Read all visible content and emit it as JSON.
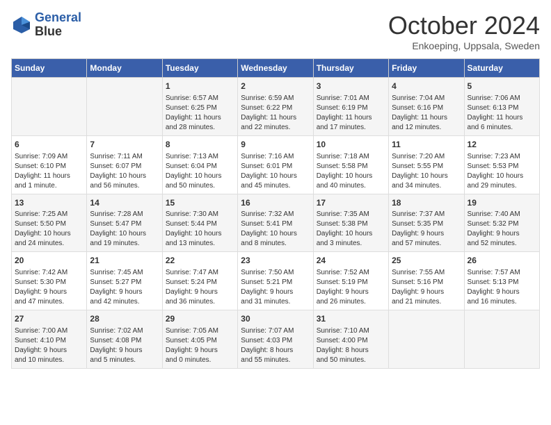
{
  "header": {
    "logo_line1": "General",
    "logo_line2": "Blue",
    "month": "October 2024",
    "location": "Enkoeping, Uppsala, Sweden"
  },
  "weekdays": [
    "Sunday",
    "Monday",
    "Tuesday",
    "Wednesday",
    "Thursday",
    "Friday",
    "Saturday"
  ],
  "weeks": [
    [
      {
        "day": "",
        "info": ""
      },
      {
        "day": "",
        "info": ""
      },
      {
        "day": "1",
        "info": "Sunrise: 6:57 AM\nSunset: 6:25 PM\nDaylight: 11 hours\nand 28 minutes."
      },
      {
        "day": "2",
        "info": "Sunrise: 6:59 AM\nSunset: 6:22 PM\nDaylight: 11 hours\nand 22 minutes."
      },
      {
        "day": "3",
        "info": "Sunrise: 7:01 AM\nSunset: 6:19 PM\nDaylight: 11 hours\nand 17 minutes."
      },
      {
        "day": "4",
        "info": "Sunrise: 7:04 AM\nSunset: 6:16 PM\nDaylight: 11 hours\nand 12 minutes."
      },
      {
        "day": "5",
        "info": "Sunrise: 7:06 AM\nSunset: 6:13 PM\nDaylight: 11 hours\nand 6 minutes."
      }
    ],
    [
      {
        "day": "6",
        "info": "Sunrise: 7:09 AM\nSunset: 6:10 PM\nDaylight: 11 hours\nand 1 minute."
      },
      {
        "day": "7",
        "info": "Sunrise: 7:11 AM\nSunset: 6:07 PM\nDaylight: 10 hours\nand 56 minutes."
      },
      {
        "day": "8",
        "info": "Sunrise: 7:13 AM\nSunset: 6:04 PM\nDaylight: 10 hours\nand 50 minutes."
      },
      {
        "day": "9",
        "info": "Sunrise: 7:16 AM\nSunset: 6:01 PM\nDaylight: 10 hours\nand 45 minutes."
      },
      {
        "day": "10",
        "info": "Sunrise: 7:18 AM\nSunset: 5:58 PM\nDaylight: 10 hours\nand 40 minutes."
      },
      {
        "day": "11",
        "info": "Sunrise: 7:20 AM\nSunset: 5:55 PM\nDaylight: 10 hours\nand 34 minutes."
      },
      {
        "day": "12",
        "info": "Sunrise: 7:23 AM\nSunset: 5:53 PM\nDaylight: 10 hours\nand 29 minutes."
      }
    ],
    [
      {
        "day": "13",
        "info": "Sunrise: 7:25 AM\nSunset: 5:50 PM\nDaylight: 10 hours\nand 24 minutes."
      },
      {
        "day": "14",
        "info": "Sunrise: 7:28 AM\nSunset: 5:47 PM\nDaylight: 10 hours\nand 19 minutes."
      },
      {
        "day": "15",
        "info": "Sunrise: 7:30 AM\nSunset: 5:44 PM\nDaylight: 10 hours\nand 13 minutes."
      },
      {
        "day": "16",
        "info": "Sunrise: 7:32 AM\nSunset: 5:41 PM\nDaylight: 10 hours\nand 8 minutes."
      },
      {
        "day": "17",
        "info": "Sunrise: 7:35 AM\nSunset: 5:38 PM\nDaylight: 10 hours\nand 3 minutes."
      },
      {
        "day": "18",
        "info": "Sunrise: 7:37 AM\nSunset: 5:35 PM\nDaylight: 9 hours\nand 57 minutes."
      },
      {
        "day": "19",
        "info": "Sunrise: 7:40 AM\nSunset: 5:32 PM\nDaylight: 9 hours\nand 52 minutes."
      }
    ],
    [
      {
        "day": "20",
        "info": "Sunrise: 7:42 AM\nSunset: 5:30 PM\nDaylight: 9 hours\nand 47 minutes."
      },
      {
        "day": "21",
        "info": "Sunrise: 7:45 AM\nSunset: 5:27 PM\nDaylight: 9 hours\nand 42 minutes."
      },
      {
        "day": "22",
        "info": "Sunrise: 7:47 AM\nSunset: 5:24 PM\nDaylight: 9 hours\nand 36 minutes."
      },
      {
        "day": "23",
        "info": "Sunrise: 7:50 AM\nSunset: 5:21 PM\nDaylight: 9 hours\nand 31 minutes."
      },
      {
        "day": "24",
        "info": "Sunrise: 7:52 AM\nSunset: 5:19 PM\nDaylight: 9 hours\nand 26 minutes."
      },
      {
        "day": "25",
        "info": "Sunrise: 7:55 AM\nSunset: 5:16 PM\nDaylight: 9 hours\nand 21 minutes."
      },
      {
        "day": "26",
        "info": "Sunrise: 7:57 AM\nSunset: 5:13 PM\nDaylight: 9 hours\nand 16 minutes."
      }
    ],
    [
      {
        "day": "27",
        "info": "Sunrise: 7:00 AM\nSunset: 4:10 PM\nDaylight: 9 hours\nand 10 minutes."
      },
      {
        "day": "28",
        "info": "Sunrise: 7:02 AM\nSunset: 4:08 PM\nDaylight: 9 hours\nand 5 minutes."
      },
      {
        "day": "29",
        "info": "Sunrise: 7:05 AM\nSunset: 4:05 PM\nDaylight: 9 hours\nand 0 minutes."
      },
      {
        "day": "30",
        "info": "Sunrise: 7:07 AM\nSunset: 4:03 PM\nDaylight: 8 hours\nand 55 minutes."
      },
      {
        "day": "31",
        "info": "Sunrise: 7:10 AM\nSunset: 4:00 PM\nDaylight: 8 hours\nand 50 minutes."
      },
      {
        "day": "",
        "info": ""
      },
      {
        "day": "",
        "info": ""
      }
    ]
  ]
}
